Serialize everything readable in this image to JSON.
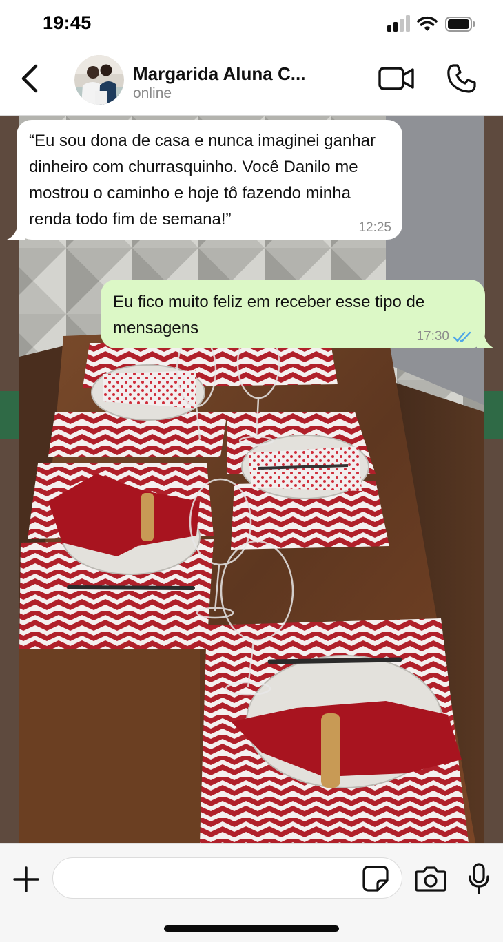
{
  "status_bar": {
    "time": "19:45",
    "icons": [
      "cellular-signal-icon",
      "wifi-icon",
      "battery-icon"
    ]
  },
  "header": {
    "back_icon": "chevron-left-icon",
    "contact_name": "Margarida Aluna C...",
    "contact_status": "online",
    "video_icon": "video-camera-icon",
    "call_icon": "phone-icon"
  },
  "chat": {
    "wallpaper": "photo of a dining table with red and white chevron placemats, plates, red napkins and wine glasses",
    "messages": [
      {
        "direction": "incoming",
        "text": "“Eu sou dona de casa e nunca imaginei ganhar dinheiro com churrasquinho. Você Danilo me mostrou o caminho e hoje tô fazendo minha renda todo fim de semana!”",
        "time": "12:25"
      },
      {
        "direction": "outgoing",
        "text": "Eu fico muito feliz em receber esse tipo de mensagens",
        "time": "17:30",
        "status_icon": "double-check-read-icon"
      }
    ]
  },
  "input_bar": {
    "plus_icon": "plus-icon",
    "message_value": "",
    "sticker_icon": "sticker-icon",
    "camera_icon": "camera-icon",
    "mic_icon": "microphone-icon"
  },
  "colors": {
    "outgoing_bubble": "#dcf8c6",
    "incoming_bubble": "#ffffff",
    "read_ticks": "#4fa6e8",
    "chevron_red": "#b0202a",
    "napkin_red": "#a8141f",
    "table_wood": "#6a4128"
  }
}
